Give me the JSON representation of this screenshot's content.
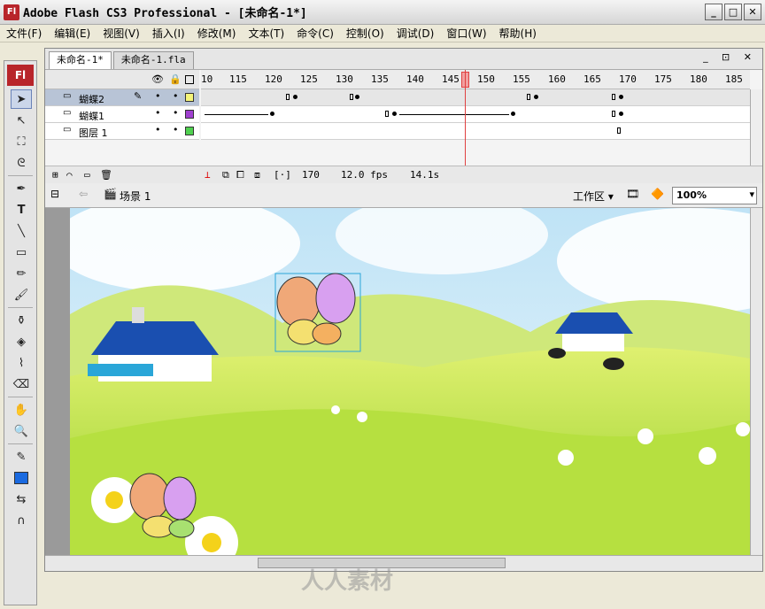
{
  "window": {
    "title": "Adobe Flash CS3 Professional - [未命名-1*]",
    "logo_text": "Fl"
  },
  "menu": [
    "文件(F)",
    "编辑(E)",
    "视图(V)",
    "插入(I)",
    "修改(M)",
    "文本(T)",
    "命令(C)",
    "控制(O)",
    "调试(D)",
    "窗口(W)",
    "帮助(H)"
  ],
  "tabs": [
    "未命名-1*",
    "未命名-1.fla"
  ],
  "timeline": {
    "ruler": [
      "10",
      "115",
      "120",
      "125",
      "130",
      "135",
      "140",
      "145",
      "150",
      "155",
      "160",
      "165",
      "170",
      "175",
      "180",
      "185"
    ],
    "layers": [
      {
        "name": "蝴蝶2",
        "color": "#f4f47a"
      },
      {
        "name": "蝴蝶1",
        "color": "#a040d0"
      },
      {
        "name": "图层 1",
        "color": "#50d050"
      }
    ],
    "status": {
      "frame": "170",
      "fps": "12.0 fps",
      "time": "14.1s"
    }
  },
  "edit_bar": {
    "scene": "场景 1",
    "workspace": "工作区",
    "zoom": "100%"
  },
  "toolbox": {
    "logo": "Fl"
  },
  "watermark": "人人素材",
  "colors": {
    "sky": "#cfe9f8",
    "grass": "#b8e040",
    "roof": "#1a4fb0"
  }
}
